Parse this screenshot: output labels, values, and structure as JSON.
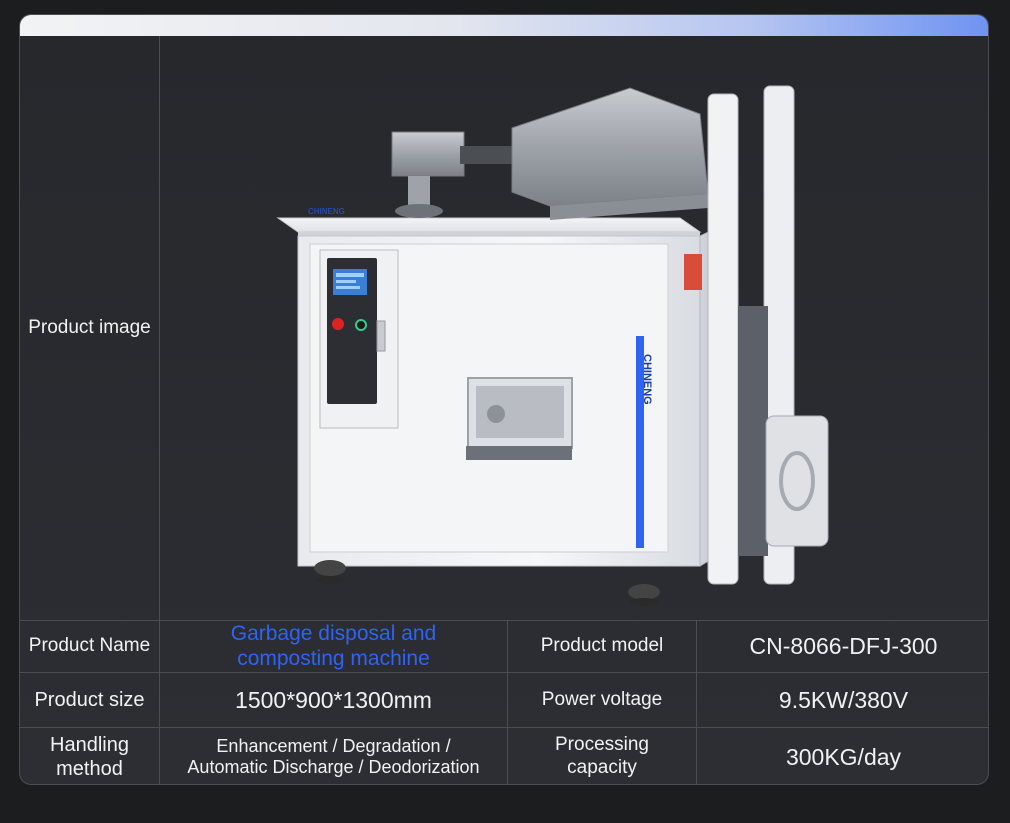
{
  "labels": {
    "product_image": "Product image",
    "product_name": "Product Name",
    "product_model": "Product model",
    "product_size": "Product size",
    "power_voltage": "Power voltage",
    "handling_method_1": "Handling",
    "handling_method_2": "method",
    "processing_capacity_1": "Processing",
    "processing_capacity_2": "capacity"
  },
  "values": {
    "product_name_1": "Garbage disposal and",
    "product_name_2": "composting machine",
    "product_model": "CN-8066-DFJ-300",
    "product_size": "1500*900*1300mm",
    "power_voltage": "9.5KW/380V",
    "handling_method_1": "Enhancement / Degradation /",
    "handling_method_2": "Automatic Discharge / Deodorization",
    "processing_capacity": "300KG/day"
  },
  "machine": {
    "brand": "CHINENG",
    "side_brand": "CHINENG"
  },
  "colors": {
    "accent_blue": "#2f63f2",
    "background": "#1c1d1f",
    "card": "#2a2c30",
    "border": "#4a4d52"
  }
}
